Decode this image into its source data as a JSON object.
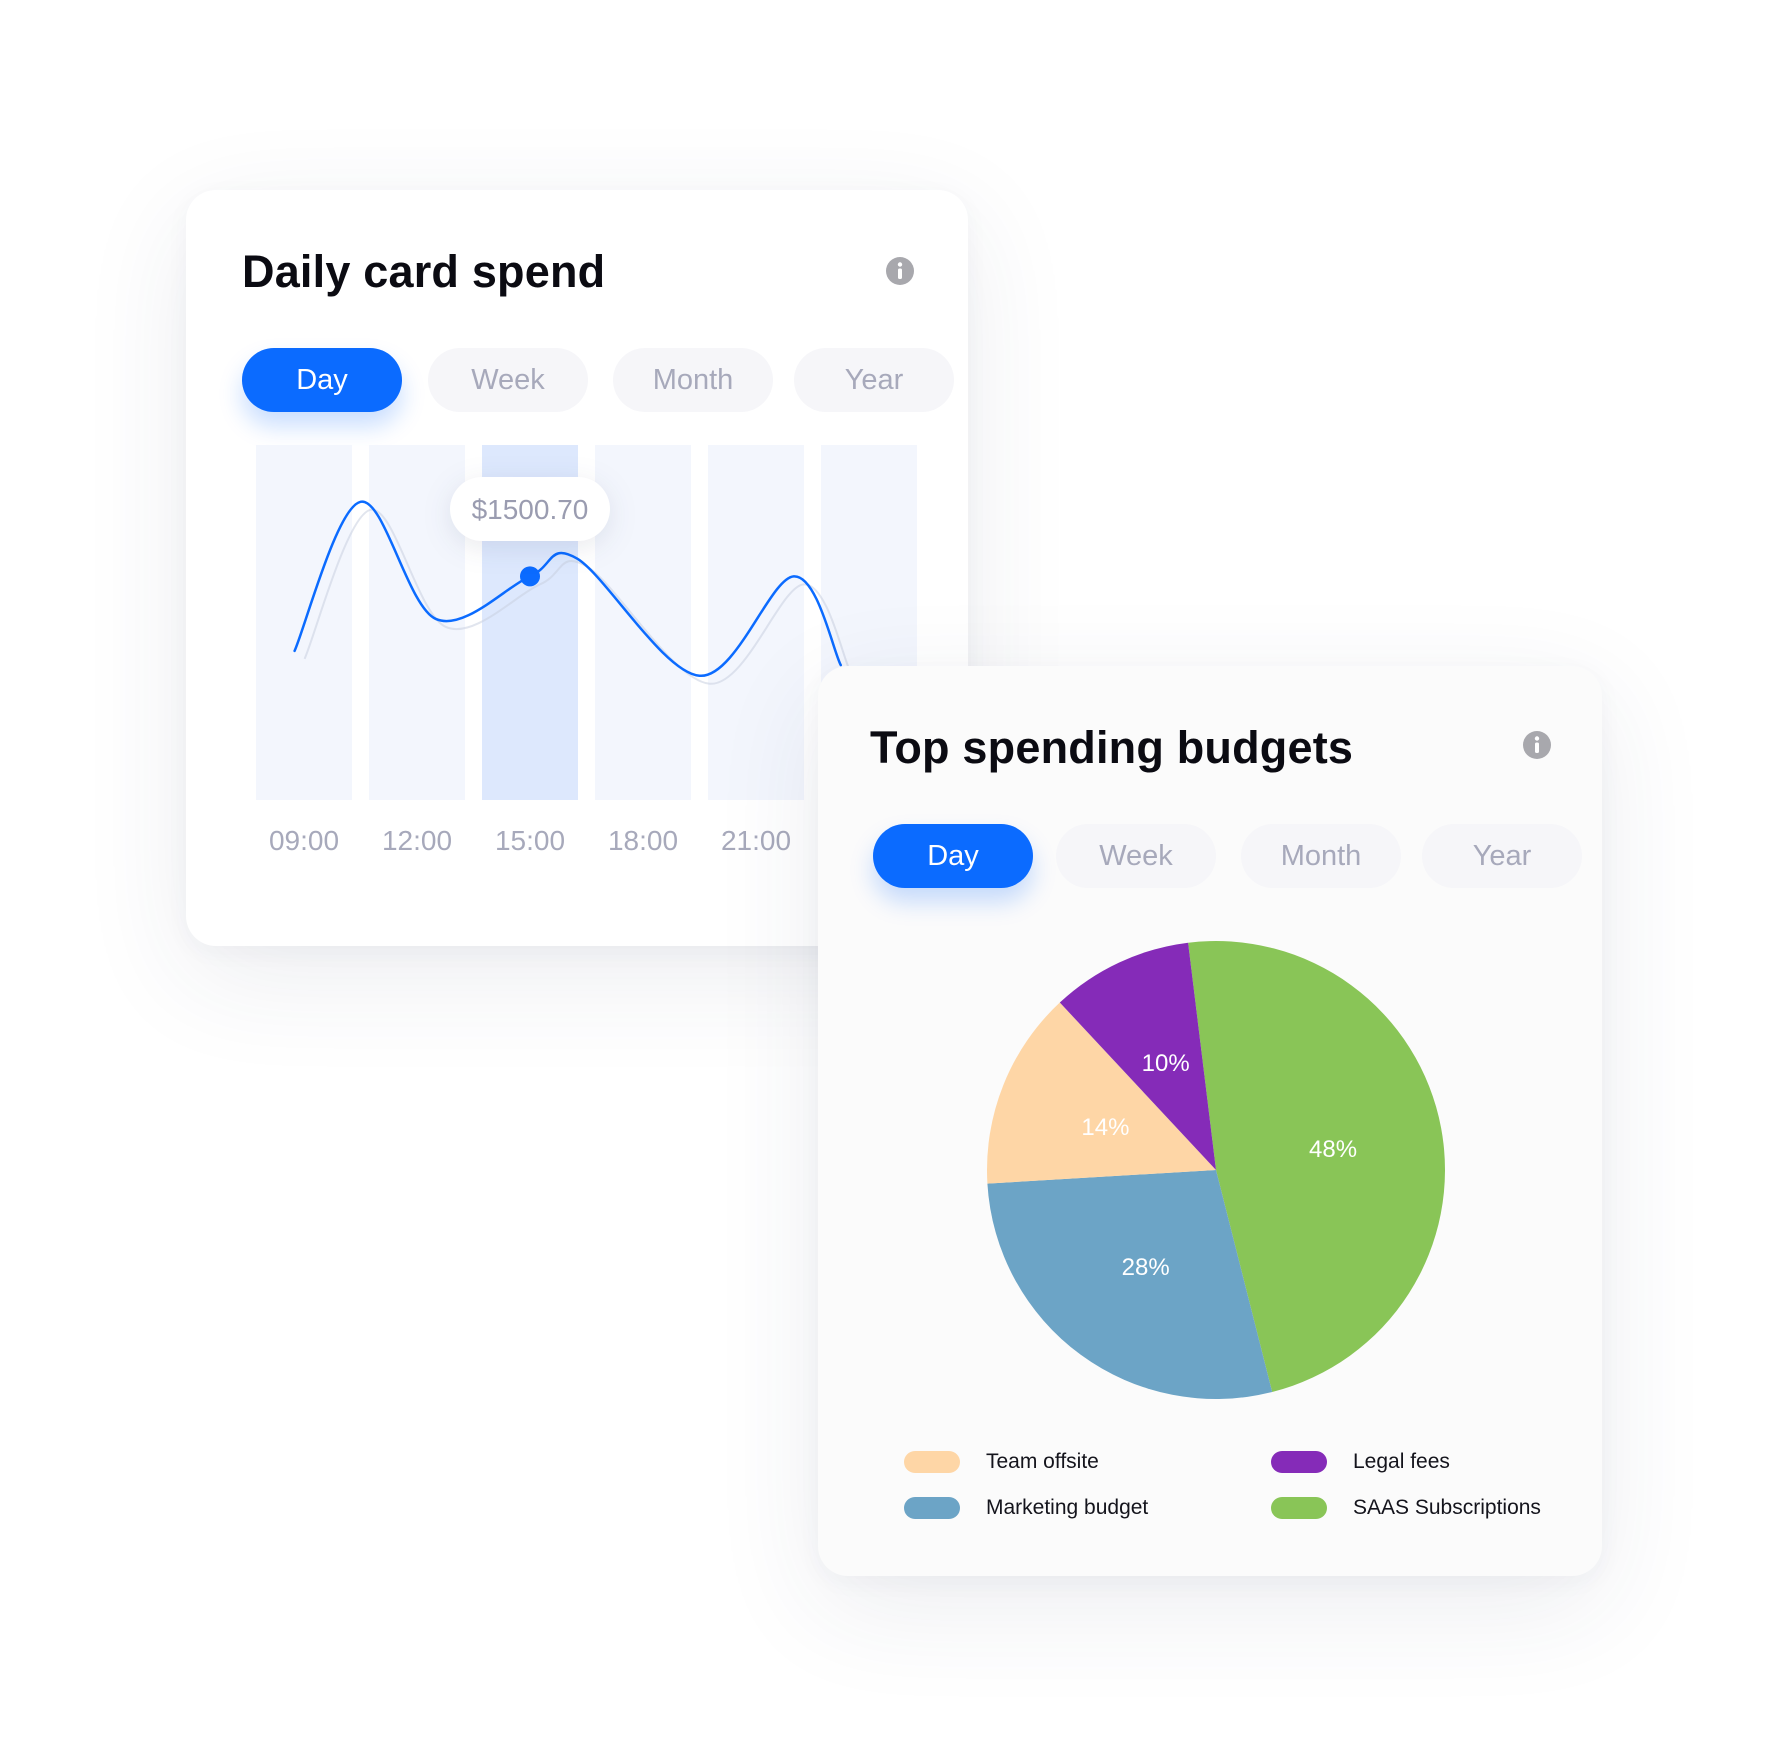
{
  "card1": {
    "title": "Daily card spend",
    "info_icon": "info-icon",
    "tabs": [
      {
        "label": "Day",
        "active": true
      },
      {
        "label": "Week",
        "active": false
      },
      {
        "label": "Month",
        "active": false
      },
      {
        "label": "Year",
        "active": false
      }
    ],
    "tooltip_value": "$1500.70",
    "highlighted_time": "15:00"
  },
  "card2": {
    "title": "Top spending budgets",
    "info_icon": "info-icon",
    "tabs": [
      {
        "label": "Day",
        "active": true
      },
      {
        "label": "Week",
        "active": false
      },
      {
        "label": "Month",
        "active": false
      },
      {
        "label": "Year",
        "active": false
      }
    ]
  },
  "colors": {
    "accent": "#0b6bff",
    "team_offsite": "#fed6a6",
    "legal_fees": "#852bb8",
    "marketing_budget": "#6ca4c6",
    "saas_subscriptions": "#89c557",
    "bar": "#f3f6fd",
    "bar_highlight": "#dde8fd"
  },
  "chart_data": [
    {
      "type": "line",
      "title": "Daily card spend",
      "categories": [
        "09:00",
        "12:00",
        "15:00",
        "18:00",
        "21:00",
        ""
      ],
      "x_tick_labels": [
        "09:00",
        "12:00",
        "15:00",
        "18:00",
        "21:00"
      ],
      "series": [
        {
          "values": [
            {
              "t": "08:45",
              "v": 0.42
            },
            {
              "t": "10:30",
              "v": 0.84
            },
            {
              "t": "12:30",
              "v": 0.51
            },
            {
              "t": "15:00",
              "v": 0.63
            },
            {
              "t": "16:15",
              "v": 0.68
            },
            {
              "t": "19:30",
              "v": 0.35
            },
            {
              "t": "22:00",
              "v": 0.63
            },
            {
              "t": "23:15",
              "v": 0.38
            }
          ]
        }
      ],
      "highlight": {
        "category": "15:00",
        "label": "$1500.70"
      },
      "y_axis_visible": false,
      "grid": false
    },
    {
      "type": "pie",
      "title": "Top spending budgets",
      "slices": [
        {
          "name": "SAAS Subscriptions",
          "value": 48,
          "label": "48%",
          "color": "#89c557"
        },
        {
          "name": "Marketing budget",
          "value": 28,
          "label": "28%",
          "color": "#6ca4c6"
        },
        {
          "name": "Team offsite",
          "value": 14,
          "label": "14%",
          "color": "#fed6a6"
        },
        {
          "name": "Legal fees",
          "value": 10,
          "label": "10%",
          "color": "#852bb8"
        }
      ],
      "legend": [
        {
          "name": "Team offsite",
          "color": "#fed6a6"
        },
        {
          "name": "Legal fees",
          "color": "#852bb8"
        },
        {
          "name": "Marketing budget",
          "color": "#6ca4c6"
        },
        {
          "name": "SAAS Subscriptions",
          "color": "#89c557"
        }
      ],
      "legend_position": "bottom"
    }
  ]
}
